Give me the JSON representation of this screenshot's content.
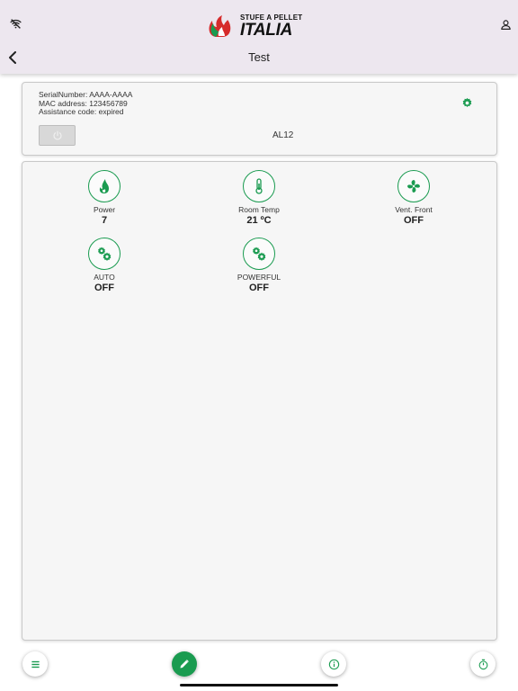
{
  "header": {
    "logo": {
      "top": "STUFE A PELLET",
      "main": "ITALIA"
    },
    "title": "Test"
  },
  "device": {
    "serial_line": "SerialNumber: AAAA-AAAA",
    "mac_line": "MAC address: 123456789",
    "assistance_line": "Assistance code: expired",
    "model": "AL12"
  },
  "status_items": [
    {
      "label": "Power",
      "value": "7",
      "icon": "flame-icon"
    },
    {
      "label": "Room Temp",
      "value": "21 ºC",
      "icon": "thermometer-icon"
    },
    {
      "label": "Vent. Front",
      "value": "OFF",
      "icon": "fan-icon"
    },
    {
      "label": "AUTO",
      "value": "OFF",
      "icon": "gears-icon"
    },
    {
      "label": "POWERFUL",
      "value": "OFF",
      "icon": "gears-icon"
    }
  ],
  "bottom_bar": [
    "list-icon",
    "edit-icon",
    "info-icon",
    "timer-icon"
  ],
  "colors": {
    "accent": "#1a9b50",
    "header_bg": "#ede7ef",
    "card_bg": "#f6f6f6"
  }
}
